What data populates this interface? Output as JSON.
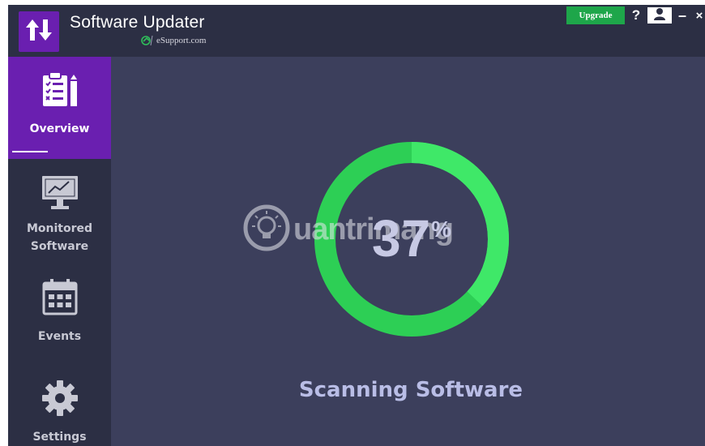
{
  "app": {
    "title": "Software Updater",
    "subtitle": "eSupport.com",
    "logo_icon": "up-down-arrows-icon",
    "brand_color": "#6a1fb0"
  },
  "titlebar": {
    "upgrade_label": "Upgrade",
    "help_label": "?",
    "minimize_label": "–",
    "close_label": "×",
    "upgrade_color": "#1ea64a"
  },
  "sidebar": {
    "items": [
      {
        "label": "Overview",
        "icon": "clipboard-checklist-icon",
        "active": true
      },
      {
        "label": "Monitored Software",
        "icon": "monitor-chart-icon",
        "active": false
      },
      {
        "label": "Events",
        "icon": "calendar-icon",
        "active": false
      },
      {
        "label": "Settings",
        "icon": "gear-icon",
        "active": false
      }
    ]
  },
  "scan": {
    "progress_percent": 37,
    "percent_number": "37",
    "percent_sign": "%",
    "status": "Scanning Software",
    "track_color": "#2dcf55",
    "progress_color": "#3fe868"
  },
  "watermark": {
    "text": "uantrimang",
    "icon": "lightbulb-icon"
  }
}
